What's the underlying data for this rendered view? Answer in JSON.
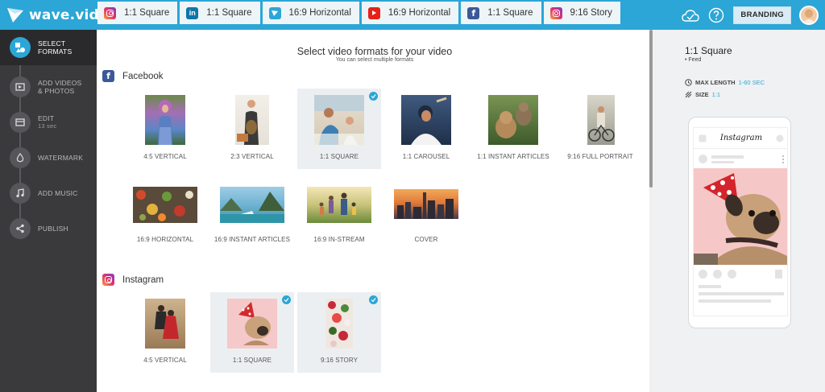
{
  "app": {
    "logo_text": "wave.video"
  },
  "tabs": [
    {
      "label": "1:1 Square",
      "network": "instagram"
    },
    {
      "label": "1:1 Square",
      "network": "linkedin"
    },
    {
      "label": "16:9 Horizontal",
      "network": "twitter"
    },
    {
      "label": "16:9 Horizontal",
      "network": "youtube"
    },
    {
      "label": "1:1 Square",
      "network": "facebook"
    },
    {
      "label": "9:16 Story",
      "network": "instagram"
    }
  ],
  "header": {
    "branding_label": "BRANDING",
    "icons": [
      "cloud-check-icon",
      "help-icon",
      "avatar"
    ]
  },
  "steps": [
    {
      "title": "SELECT",
      "title2": "FORMATS",
      "sub": "",
      "icon": "shapes-icon",
      "active": true
    },
    {
      "title": "ADD VIDEOS",
      "title2": "& PHOTOS",
      "sub": "",
      "icon": "media-icon",
      "active": false
    },
    {
      "title": "EDIT",
      "title2": "",
      "sub": "13 sec",
      "icon": "film-icon",
      "active": false
    },
    {
      "title": "WATERMARK",
      "title2": "",
      "sub": "",
      "icon": "drop-icon",
      "active": false
    },
    {
      "title": "ADD MUSIC",
      "title2": "",
      "sub": "",
      "icon": "music-icon",
      "active": false
    },
    {
      "title": "PUBLISH",
      "title2": "",
      "sub": "",
      "icon": "share-icon",
      "active": false
    }
  ],
  "main": {
    "title": "Select video formats for your video",
    "subtitle": "You can select multiple formats",
    "facebook": {
      "label": "Facebook",
      "formats": [
        {
          "label": "4:5 VERTICAL",
          "selected": false
        },
        {
          "label": "2:3 VERTICAL",
          "selected": false
        },
        {
          "label": "1:1 SQUARE",
          "selected": true
        },
        {
          "label": "1:1 CAROUSEL",
          "selected": false
        },
        {
          "label": "1:1 INSTANT ARTICLES",
          "selected": false
        },
        {
          "label": "9:16 FULL PORTRAIT",
          "selected": false
        },
        {
          "label": "16:9 HORIZONTAL",
          "selected": false
        },
        {
          "label": "16:9 INSTANT ARTICLES",
          "selected": false
        },
        {
          "label": "16:9 IN-STREAM",
          "selected": false
        },
        {
          "label": "COVER",
          "selected": false
        }
      ]
    },
    "instagram": {
      "label": "Instagram",
      "formats": [
        {
          "label": "4:5 VERTICAL",
          "selected": false
        },
        {
          "label": "1:1 SQUARE",
          "selected": true
        },
        {
          "label": "9:16 STORY",
          "selected": true
        }
      ]
    }
  },
  "preview": {
    "title": "1:1 Square",
    "subtitle": "• Feed",
    "max_length_label": "MAX LENGTH",
    "max_length_value": "1-60 SEC",
    "size_label": "SIZE",
    "size_value": "1:1",
    "phone_app_label": "Instagram"
  },
  "colors": {
    "accent": "#2ba6d6",
    "sidebar": "#3a3a3c",
    "facebook": "#3b5998"
  }
}
